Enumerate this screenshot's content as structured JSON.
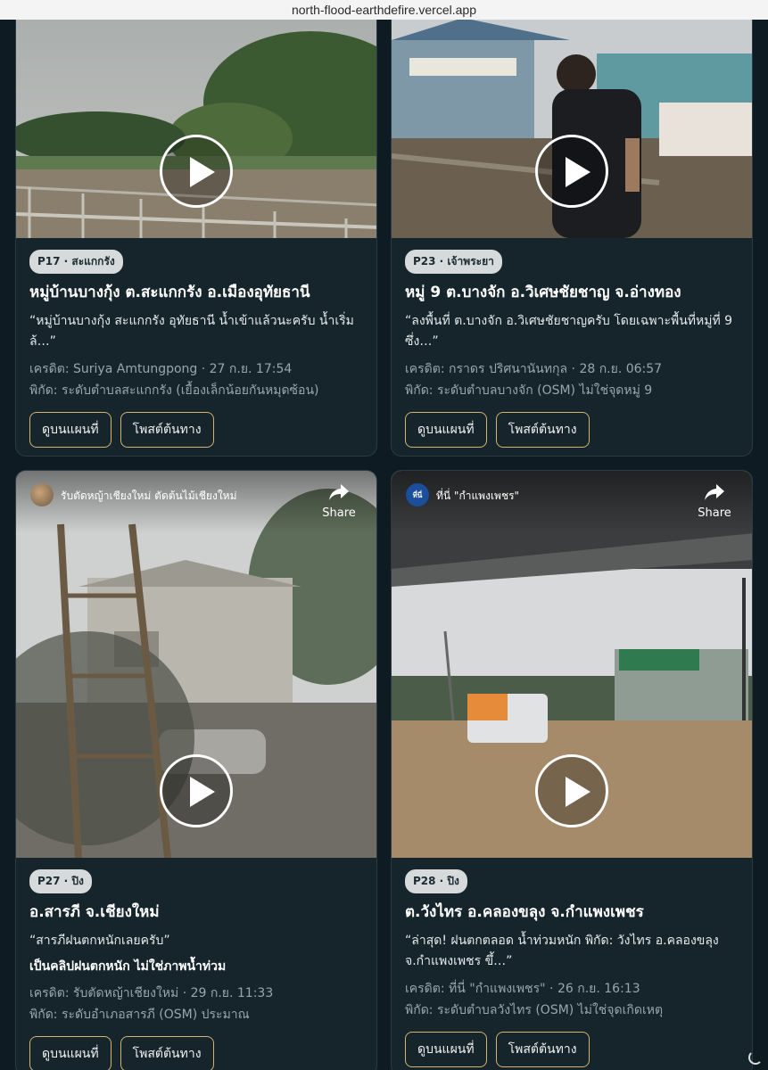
{
  "browser": {
    "url": "north-flood-earthdefire.vercel.app"
  },
  "cards": [
    {
      "badge": "P17 · สะแกกรัง",
      "title": "หมู่บ้านบางกุ้ง ต.สะแกกรัง อ.เมืองอุทัยธานี",
      "quote": "“หมู่บ้านบางกุ้ง สะแกกรัง อุทัยธานี น้ำเข้าแล้วนะครับ น้ำเริ่มล้…”",
      "credit": "เครดิต: Suriya Amtungpong · 27 ก.ย. 17:54",
      "coords": "พิกัด: ระดับตำบลสะแกกรัง (เยื้องเล็กน้อยกันหมุดซ้อน)",
      "btn_map": "ดูบนแผนที่",
      "btn_post": "โพสต์ต้นทาง"
    },
    {
      "badge": "P23 · เจ้าพระยา",
      "title": "หมู่ 9 ต.บางจัก อ.วิเศษชัยชาญ จ.อ่างทอง",
      "quote": "“ลงพื้นที่ ต.บางจัก อ.วิเศษชัยชาญครับ โดยเฉพาะพื้นที่หมู่ที่ 9 ซึ่ง…”",
      "credit": "เครดิต: กราดร ปริศนานันทกุล · 28 ก.ย. 06:57",
      "coords": "พิกัด: ระดับตำบลบางจัก (OSM) ไม่ใช่จุดหมู่ 9",
      "btn_map": "ดูบนแผนที่",
      "btn_post": "โพสต์ต้นทาง"
    },
    {
      "embed_title": "รับตัดหญ้าเชียงใหม่ ตัดต้นไม้เชียงใหม่",
      "share": "Share",
      "badge": "P27 · ปิง",
      "title": "อ.สารภี จ.เชียงใหม่",
      "quote": "“สารภีฝนตกหนักเลยครับ”",
      "note": "เป็นคลิปฝนตกหนัก ไม่ใช่ภาพน้ำท่วม",
      "credit": "เครดิต: รับตัดหญ้าเชียงใหม่ · 29 ก.ย. 11:33",
      "coords": "พิกัด: ระดับอำเภอสารภี (OSM) ประมาณ",
      "btn_map": "ดูบนแผนที่",
      "btn_post": "โพสต์ต้นทาง"
    },
    {
      "embed_avatar": "ที่นี่",
      "embed_title": "ที่นี่ \"กำแพงเพชร\"",
      "share": "Share",
      "badge": "P28 · ปิง",
      "title": "ต.วังไทร อ.คลองขลุง จ.กำแพงเพชร",
      "quote": "“ล่าสุด! ฝนตกตลอด น้ำท่วมหนัก พิกัด: วังไทร อ.คลองขลุง จ.กำแพงเพชร ขึ้…”",
      "credit": "เครดิต: ที่นี่ \"กำแพงเพชร\" · 26 ก.ย. 16:13",
      "coords": "พิกัด: ระดับตำบลวังไทร (OSM) ไม่ใช่จุดเกิดเหตุ",
      "btn_map": "ดูบนแผนที่",
      "btn_post": "โพสต์ต้นทาง"
    }
  ]
}
